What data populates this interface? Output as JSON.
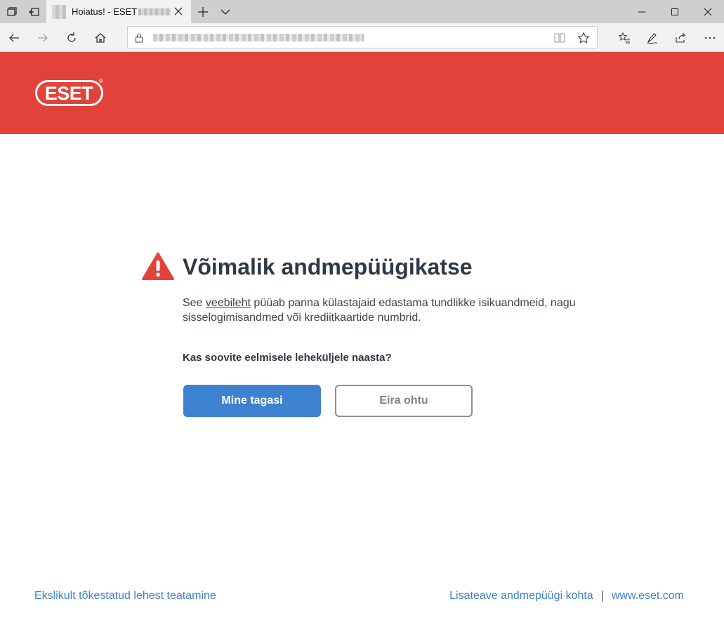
{
  "browser": {
    "tab_title": "Hoiatus! - ESET",
    "url_placeholder": ""
  },
  "brand": {
    "logo_text": "ESET",
    "registered_mark": "®",
    "banner_color": "#e1433b"
  },
  "warning": {
    "title": "Võimalik andmepüügikatse",
    "desc_before": "See ",
    "desc_link": "veebileht",
    "desc_after": " püüab panna külastajaid edastama tundlikke isikuandmeid, nagu sisselogimisandmed või krediitkaartide numbrid.",
    "question": "Kas soovite eelmisele leheküljele naasta?",
    "icon": "warning-triangle-icon",
    "icon_color": "#e1433b"
  },
  "buttons": {
    "go_back": "Mine tagasi",
    "ignore": "Eira ohtu",
    "primary_color": "#3d82d0"
  },
  "footer": {
    "report_link": "Ekslikult tõkestatud lehest teatamine",
    "more_info_link": "Lisateave andmepüügi kohta",
    "separator": "|",
    "site_link": "www.eset.com",
    "link_color": "#3d82d0"
  }
}
